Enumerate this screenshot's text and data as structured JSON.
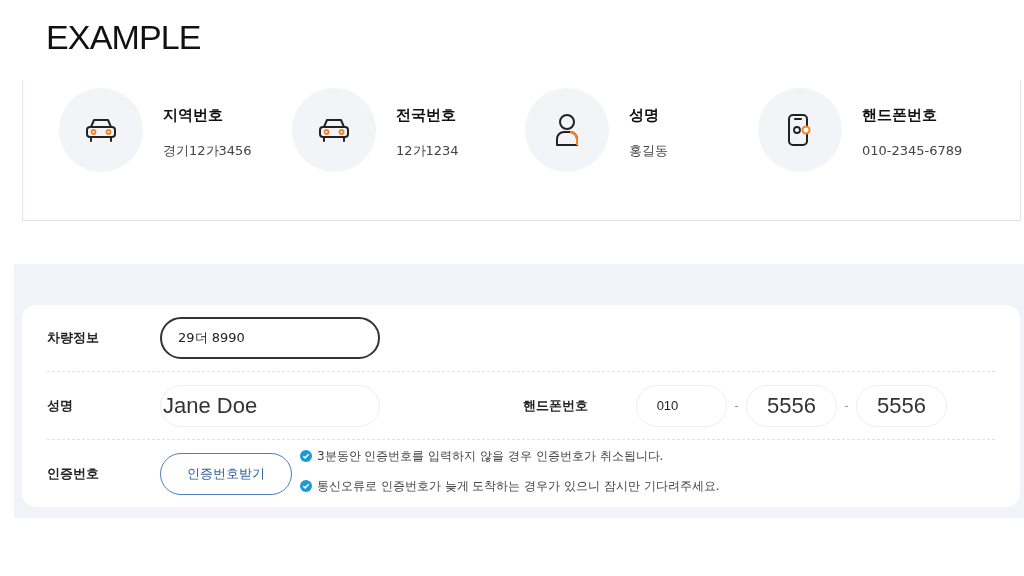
{
  "title": "EXAMPLE",
  "summary": [
    {
      "kind": "car",
      "label": "지역번호",
      "value": "경기12가3456"
    },
    {
      "kind": "car",
      "label": "전국번호",
      "value": "12가1234"
    },
    {
      "kind": "person",
      "label": "성명",
      "value": "홍길동"
    },
    {
      "kind": "phone",
      "label": "핸드폰번호",
      "value": "010-2345-6789"
    }
  ],
  "form": {
    "vehicle": {
      "label": "차량정보",
      "value": "29더 8990",
      "focused": true
    },
    "name": {
      "label": "성명",
      "value": "Jane Doe",
      "autofilled": true
    },
    "phone": {
      "label": "핸드폰번호",
      "separators": [
        "-",
        "-"
      ],
      "parts": [
        {
          "value": "010",
          "autofilled": false
        },
        {
          "value": "5556",
          "autofilled": true
        },
        {
          "value": "5556",
          "autofilled": true
        }
      ]
    },
    "auth": {
      "label": "인증번호",
      "button": "인증번호받기",
      "notes": [
        "3분동안 인증번호를 입력하지 않을 경우 인증번호가 취소됩니다.",
        "통신오류로 인증번호가 늦게 도착하는 경우가 있으니 잠시만 기다려주세요."
      ]
    }
  }
}
